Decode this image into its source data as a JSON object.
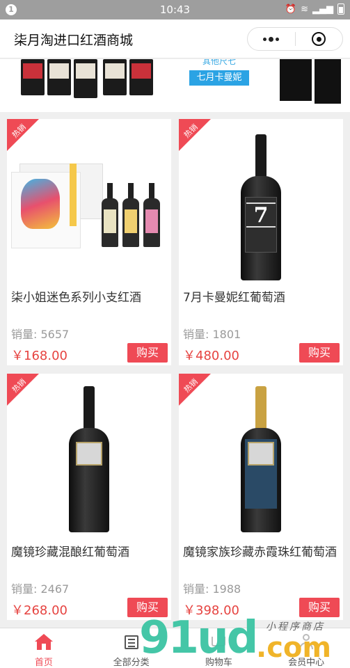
{
  "statusbar": {
    "notification_count": "1",
    "time": "10:43"
  },
  "navbar": {
    "title": "柒月淘进口红酒商城"
  },
  "banner": {
    "promo_tag": "七月卡曼妮",
    "promo_text_top": "其他尺七"
  },
  "products": [
    {
      "badge": "热销",
      "name": "柒小姐迷色系列小支红酒",
      "sales": "销量: 5657",
      "price": "￥168.00",
      "buy_label": "购买"
    },
    {
      "badge": "热销",
      "name": "7月卡曼妮红葡萄酒",
      "sales": "销量: 1801",
      "price": "￥480.00",
      "buy_label": "购买"
    },
    {
      "badge": "热销",
      "name": "魔镜珍藏混酿红葡萄酒",
      "sales": "销量: 2467",
      "price": "￥268.00",
      "buy_label": "购买"
    },
    {
      "badge": "热销",
      "name": "魔镜家族珍藏赤霞珠红葡萄酒",
      "sales": "销量: 1988",
      "price": "￥398.00",
      "buy_label": "购买"
    }
  ],
  "tabbar": {
    "home": "首页",
    "categories": "全部分类",
    "cart": "购物车",
    "member": "会员中心"
  },
  "watermark": {
    "big": "91ud",
    "com": ".com",
    "small": "小程序商店"
  },
  "colors": {
    "accent": "#ef4a55",
    "price": "#e64340"
  }
}
